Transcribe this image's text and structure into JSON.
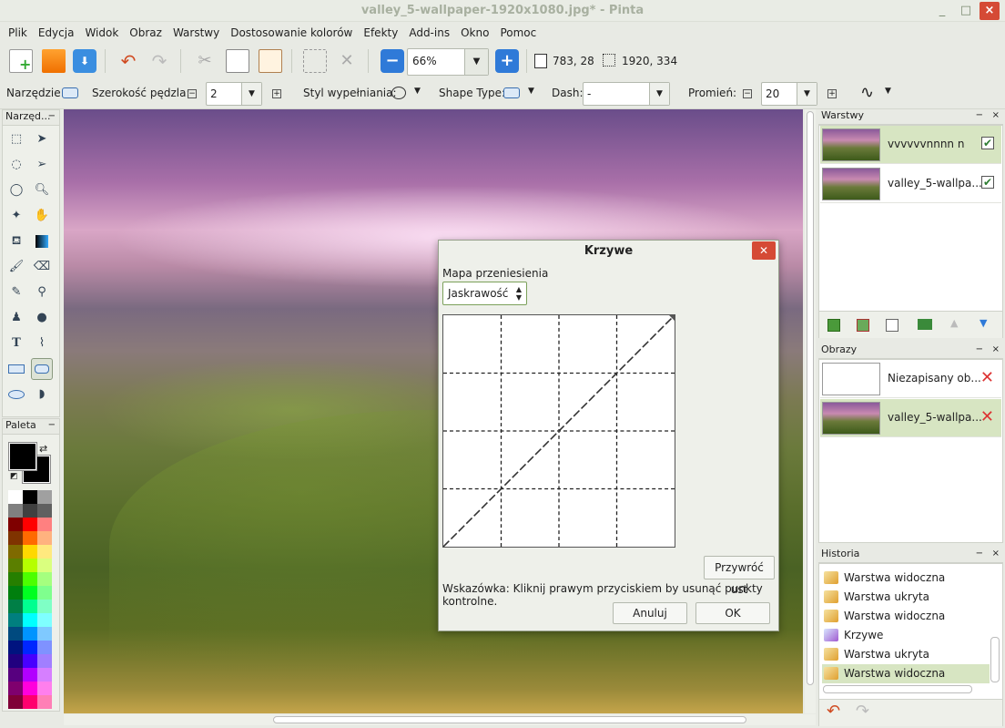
{
  "window": {
    "title": "valley_5-wallpaper-1920x1080.jpg* - Pinta",
    "minimize": "_",
    "maximize": "□",
    "close": "×"
  },
  "menu": [
    "Plik",
    "Edycja",
    "Widok",
    "Obraz",
    "Warstwy",
    "Dostosowanie kolorów",
    "Efekty",
    "Add-ins",
    "Okno",
    "Pomoc"
  ],
  "toolbar": {
    "zoom": "66%",
    "cursor_pos": "783, 28",
    "selection_size": "1920, 334"
  },
  "options": {
    "tool_label": "Narzędzie:",
    "brush_width_label": "Szerokość pędzla:",
    "brush_width": "2",
    "fill_style_label": "Styl wypełniania:",
    "shape_type_label": "Shape Type:",
    "dash_label": "Dash:",
    "dash_value": "-",
    "radius_label": "Promień:",
    "radius": "20"
  },
  "tools_panel": {
    "title": "Narzęd..."
  },
  "palette_panel": {
    "title": "Paleta"
  },
  "layers_panel": {
    "title": "Warstwy",
    "items": [
      {
        "name": "vvvvvvnnnn n",
        "visible": true,
        "selected": true
      },
      {
        "name": "valley_5-wallpa...",
        "visible": true,
        "selected": false
      }
    ]
  },
  "images_panel": {
    "title": "Obrazy",
    "items": [
      {
        "name": "Niezapisany ob...",
        "selected": false
      },
      {
        "name": "valley_5-wallpa...",
        "selected": true
      }
    ]
  },
  "history_panel": {
    "title": "Historia",
    "items": [
      "Warstwa widoczna",
      "Warstwa ukryta",
      "Warstwa widoczna",
      "Krzywe",
      "Warstwa ukryta",
      "Warstwa widoczna"
    ]
  },
  "dialog": {
    "title": "Krzywe",
    "map_label": "Mapa przeniesienia",
    "map_value": "Jaskrawość",
    "reset_label": "Przywróć ust",
    "hint": "Wskazówka: Kliknij prawym przyciskiem by usunąć punkty kontrolne.",
    "cancel": "Anuluj",
    "ok": "OK"
  },
  "palette_colors": [
    "#ffffff",
    "#000000",
    "#a0a0a0",
    "#808080",
    "#404040",
    "#606060",
    "#7f0000",
    "#ff0000",
    "#ff8080",
    "#7f3300",
    "#ff6a00",
    "#ffb27f",
    "#7f6a00",
    "#ffd800",
    "#ffe97f",
    "#5b7f00",
    "#b6ff00",
    "#daff7f",
    "#267f00",
    "#4cff00",
    "#a5ff7f",
    "#007f0e",
    "#00ff21",
    "#7fff8e",
    "#007f46",
    "#00ff90",
    "#7fffc5",
    "#007f7f",
    "#00ffff",
    "#7fffff",
    "#004a7f",
    "#0094ff",
    "#7fc9ff",
    "#00137f",
    "#0026ff",
    "#7f92ff",
    "#21007f",
    "#4800ff",
    "#a17fff",
    "#57007f",
    "#b200ff",
    "#d67fff",
    "#7f006e",
    "#ff00dc",
    "#ff7fed",
    "#7f0037",
    "#ff006e",
    "#ff7fb6"
  ]
}
